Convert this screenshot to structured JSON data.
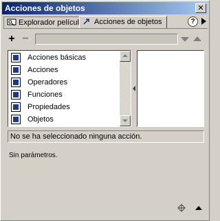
{
  "window": {
    "title": "Acciones de objetos"
  },
  "tabs": [
    {
      "label": "Explorador películas",
      "icon": "movie-explorer-icon",
      "active": false
    },
    {
      "label": "Acciones de objetos",
      "icon": "object-actions-icon",
      "active": true
    }
  ],
  "toolbar": {
    "add_label": "+",
    "remove_label": "−"
  },
  "actions_list": {
    "items": [
      {
        "label": "Acciones básicas"
      },
      {
        "label": "Acciones"
      },
      {
        "label": "Operadores"
      },
      {
        "label": "Funciones"
      },
      {
        "label": "Propiedades"
      },
      {
        "label": "Objetos"
      }
    ]
  },
  "status": {
    "message": "No se ha seleccionado ninguna acción."
  },
  "parameters": {
    "message": "Sin parámetros."
  },
  "colors": {
    "titlebar_start": "#0a246a",
    "titlebar_end": "#a6caf0",
    "face": "#d4d0c8",
    "bullet": "#1a3a8a"
  }
}
